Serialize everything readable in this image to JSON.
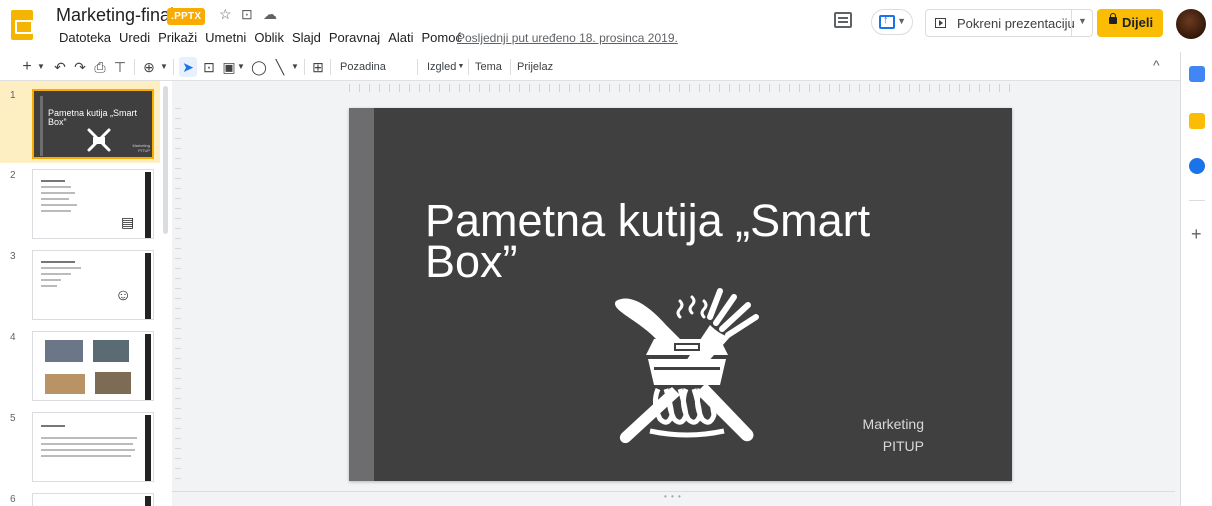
{
  "header": {
    "title": "Marketing-final.",
    "extension": ".PPTX",
    "menu": [
      "Datoteka",
      "Uredi",
      "Prikaži",
      "Umetni",
      "Oblik",
      "Slajd",
      "Poravnaj",
      "Alati",
      "Pomoć"
    ],
    "last_edit": "Posljednji put uređeno 18. prosinca 2019.",
    "present_label": "Pokreni prezentaciju",
    "share_label": "Dijeli"
  },
  "toolbar": {
    "background_label": "Pozadina",
    "layout_label": "Izgled",
    "theme_label": "Tema",
    "transition_label": "Prijelaz"
  },
  "filmstrip": {
    "numbers": [
      "1",
      "2",
      "3",
      "4",
      "5",
      "6"
    ],
    "thumb1_title": "Pametna kutija „Smart Box”",
    "thumb1_sub": "Marketing PITUP"
  },
  "slide": {
    "title": "Pametna kutija „Smart Box”",
    "subtitle_line1": "Marketing",
    "subtitle_line2": "PITUP",
    "background": "#404040",
    "bar_color": "#6d6d6f"
  },
  "colors": {
    "accent": "#f9ab00",
    "share": "#fbbc04",
    "brand_blue": "#1a73e8"
  }
}
